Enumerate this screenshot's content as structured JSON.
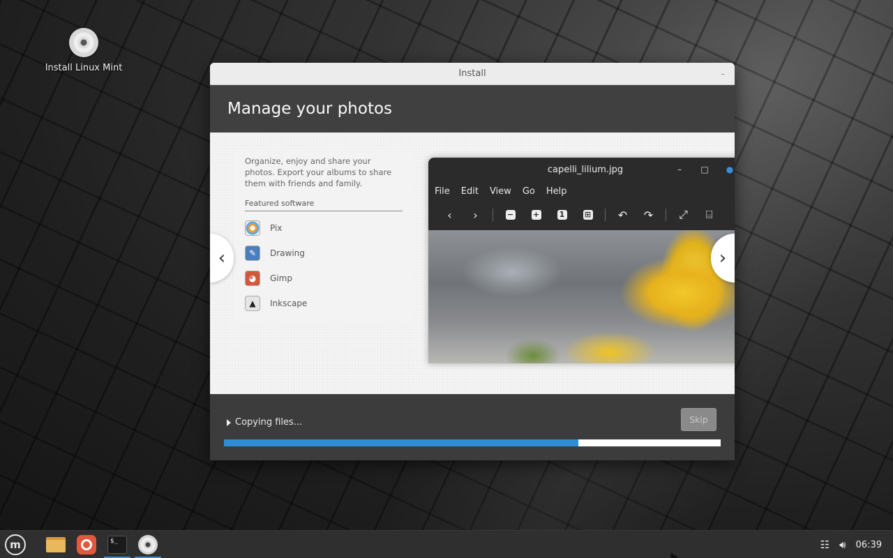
{
  "desktop": {
    "icons": [
      {
        "label": "Install Linux Mint",
        "icon": "cd-disc-icon"
      }
    ]
  },
  "installer": {
    "window_title": "Install",
    "minimize_glyph": "–",
    "page_title": "Manage your photos",
    "slide": {
      "description": "Organize, enjoy and share your photos. Export your albums to share them with friends and family.",
      "featured_label": "Featured software",
      "apps": [
        {
          "name": "Pix",
          "icon": "pix-icon",
          "color": "#e8e8e8"
        },
        {
          "name": "Drawing",
          "icon": "drawing-icon",
          "color": "#4a7fbf"
        },
        {
          "name": "Gimp",
          "icon": "gimp-icon",
          "color": "#d2583a"
        },
        {
          "name": "Inkscape",
          "icon": "inkscape-icon",
          "color": "#e5e5e5"
        }
      ],
      "prev_glyph": "‹",
      "next_glyph": "›",
      "viewer": {
        "title": "capelli_lilium.jpg",
        "menu": [
          "File",
          "Edit",
          "View",
          "Go",
          "Help"
        ]
      }
    },
    "status_text": "Copying files...",
    "skip_label": "Skip",
    "progress": 0.713,
    "progress_color": "#2d8fd2"
  },
  "taskbar": {
    "launchers": [
      {
        "name": "menu",
        "icon": "linux-mint-menu-icon",
        "active": false
      },
      {
        "name": "files",
        "icon": "folder-icon",
        "active": false
      },
      {
        "name": "firefox",
        "icon": "firefox-icon",
        "active": false
      },
      {
        "name": "terminal",
        "icon": "terminal-icon",
        "active": true
      },
      {
        "name": "installer",
        "icon": "cd-disc-icon",
        "active": true
      }
    ],
    "terminal_glyph": "$_",
    "mint_glyph": "m",
    "clock": "06:39"
  }
}
